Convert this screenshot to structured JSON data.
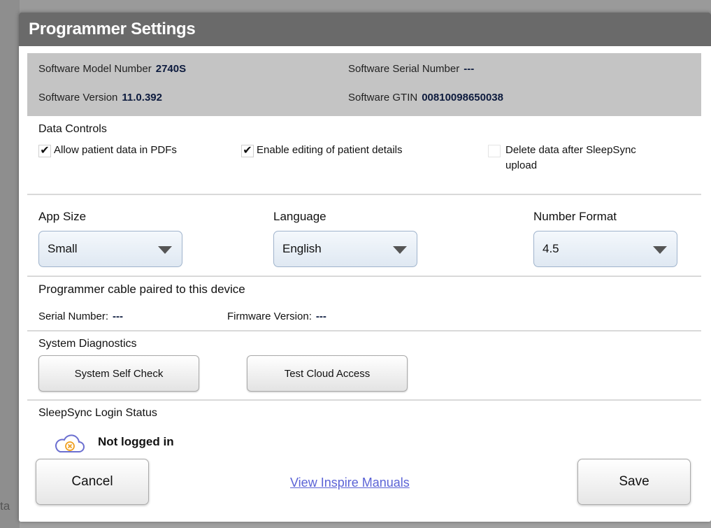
{
  "backdrop": {
    "partial_text": "ta"
  },
  "dialog": {
    "title": "Programmer Settings"
  },
  "info": {
    "model_label": "Software Model Number",
    "model_value": "2740S",
    "serial_label": "Software Serial Number",
    "serial_value": "---",
    "version_label": "Software Version",
    "version_value": "11.0.392",
    "gtin_label": "Software GTIN",
    "gtin_value": "00810098650038"
  },
  "data_controls": {
    "title": "Data Controls",
    "options": [
      {
        "label": "Allow patient data in PDFs",
        "checked": true
      },
      {
        "label": "Enable editing of patient details",
        "checked": true
      },
      {
        "label_line1": "Delete data after SleepSync",
        "label_line2": "upload",
        "checked": false
      }
    ]
  },
  "preferences": {
    "app_size": {
      "label": "App Size",
      "value": "Small"
    },
    "language": {
      "label": "Language",
      "value": "English"
    },
    "number_format": {
      "label": "Number Format",
      "value": "4.5"
    }
  },
  "cable": {
    "title": "Programmer cable paired to this device",
    "serial_label": "Serial Number:",
    "serial_value": "---",
    "firmware_label": "Firmware Version:",
    "firmware_value": "---"
  },
  "diagnostics": {
    "title": "System Diagnostics",
    "self_check_label": "System Self Check",
    "cloud_label": "Test Cloud Access"
  },
  "login": {
    "title": "SleepSync Login Status",
    "status": "Not logged in",
    "icon": "cloud-error-icon"
  },
  "footer": {
    "cancel_label": "Cancel",
    "manuals_label": "View Inspire Manuals",
    "save_label": "Save"
  },
  "colors": {
    "title_bar": "#6a6a6a",
    "info_band": "#c4c4c4",
    "value_text": "#0d1b3e",
    "link": "#5b63d6",
    "cloud_icon": "#f0a020"
  }
}
